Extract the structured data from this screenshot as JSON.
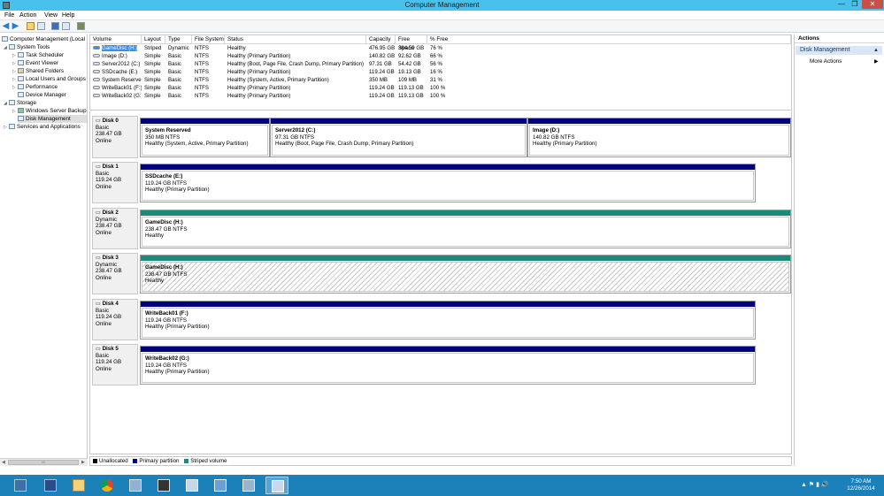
{
  "window": {
    "title": "Computer Management",
    "min": "—",
    "max": "❐",
    "close": "✕"
  },
  "menu": [
    "File",
    "Action",
    "View",
    "Help"
  ],
  "tree": {
    "root": "Computer Management (Local",
    "system_tools": "System Tools",
    "task_scheduler": "Task Scheduler",
    "event_viewer": "Event Viewer",
    "shared_folders": "Shared Folders",
    "local_users": "Local Users and Groups",
    "performance": "Performance",
    "device_manager": "Device Manager",
    "storage": "Storage",
    "wsb": "Windows Server Backup",
    "disk_mgmt": "Disk Management",
    "services": "Services and Applications",
    "hscroll_thumb": "III"
  },
  "volumes": {
    "headers": [
      "Volume",
      "Layout",
      "Type",
      "File System",
      "Status",
      "Capacity",
      "Free Space",
      "% Free"
    ],
    "rows": [
      [
        "GameDisc (H:)",
        "Striped",
        "Dynamic",
        "NTFS",
        "Healthy",
        "476.95 GB",
        "364.59 GB",
        "76 %"
      ],
      [
        "Image (D:)",
        "Simple",
        "Basic",
        "NTFS",
        "Healthy (Primary Partition)",
        "140.82 GB",
        "92.62 GB",
        "66 %"
      ],
      [
        "Server2012 (C:)",
        "Simple",
        "Basic",
        "NTFS",
        "Healthy (Boot, Page File, Crash Dump, Primary Partition)",
        "97.31 GB",
        "54.42 GB",
        "56 %"
      ],
      [
        "SSDcache (E:)",
        "Simple",
        "Basic",
        "NTFS",
        "Healthy (Primary Partition)",
        "119.24 GB",
        "19.13 GB",
        "16 %"
      ],
      [
        "System Reserved",
        "Simple",
        "Basic",
        "NTFS",
        "Healthy (System, Active, Primary Partition)",
        "350 MB",
        "109 MB",
        "31 %"
      ],
      [
        "WriteBack01 (F:)",
        "Simple",
        "Basic",
        "NTFS",
        "Healthy (Primary Partition)",
        "119.24 GB",
        "119.13 GB",
        "100 %"
      ],
      [
        "WriteBack02 (G:)",
        "Simple",
        "Basic",
        "NTFS",
        "Healthy (Primary Partition)",
        "119.24 GB",
        "119.13 GB",
        "100 %"
      ]
    ]
  },
  "disks": [
    {
      "name": "Disk 0",
      "kind": "Basic",
      "size": "238.47 GB",
      "state": "Online",
      "parts": [
        {
          "name": "System Reserved",
          "size": "350 MB NTFS",
          "status": "Healthy (System, Active, Primary Partition)",
          "color": "#000080"
        },
        {
          "name": "Server2012  (C:)",
          "size": "97.31 GB NTFS",
          "status": "Healthy (Boot, Page File, Crash Dump, Primary Partition)",
          "color": "#000080"
        },
        {
          "name": "Image  (D:)",
          "size": "140.82 GB NTFS",
          "status": "Healthy (Primary Partition)",
          "color": "#000080"
        }
      ]
    },
    {
      "name": "Disk 1",
      "kind": "Basic",
      "size": "119.24 GB",
      "state": "Online",
      "parts": [
        {
          "name": "SSDcache  (E:)",
          "size": "119.24 GB NTFS",
          "status": "Healthy (Primary Partition)",
          "color": "#000080"
        }
      ]
    },
    {
      "name": "Disk 2",
      "kind": "Dynamic",
      "size": "238.47 GB",
      "state": "Online",
      "parts": [
        {
          "name": "GameDisc  (H:)",
          "size": "238.47 GB NTFS",
          "status": "Healthy",
          "color": "#1a8a7a"
        }
      ]
    },
    {
      "name": "Disk 3",
      "kind": "Dynamic",
      "size": "238.47 GB",
      "state": "Online",
      "parts": [
        {
          "name": "GameDisc  (H:)",
          "size": "238.47 GB NTFS",
          "status": "Healthy",
          "color": "#1a8a7a"
        }
      ]
    },
    {
      "name": "Disk 4",
      "kind": "Basic",
      "size": "119.24 GB",
      "state": "Online",
      "parts": [
        {
          "name": "WriteBack01  (F:)",
          "size": "119.24 GB NTFS",
          "status": "Healthy (Primary Partition)",
          "color": "#000080"
        }
      ]
    },
    {
      "name": "Disk 5",
      "kind": "Basic",
      "size": "119.24 GB",
      "state": "Online",
      "parts": [
        {
          "name": "WriteBack02  (G:)",
          "size": "119.24 GB NTFS",
          "status": "Healthy (Primary Partition)",
          "color": "#000080"
        }
      ]
    }
  ],
  "legend": {
    "unallocated": "Unallocated",
    "primary": "Primary partition",
    "striped": "Striped volume",
    "colors": {
      "unallocated": "#000000",
      "primary": "#000080",
      "striped": "#1a8a7a"
    }
  },
  "actions": {
    "title": "Actions",
    "section": "Disk Management",
    "more": "More Actions",
    "chevron": "▲",
    "more_arrow": "▶"
  },
  "taskbar": {
    "tray": "▲ ⚑ ▮ 🔊",
    "time": "7:50 AM",
    "date": "12/26/2014"
  }
}
